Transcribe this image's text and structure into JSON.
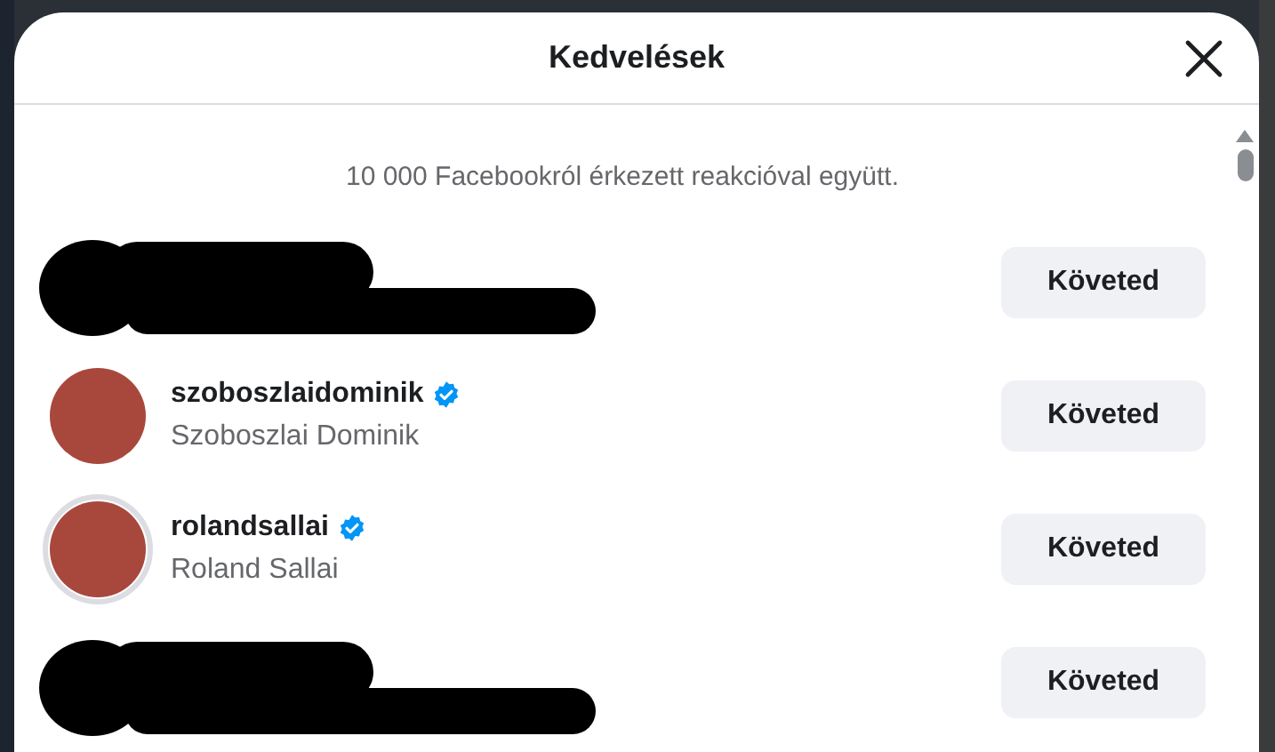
{
  "dialog": {
    "title": "Kedvelések",
    "summary": "10 000 Facebookról érkezett reakcióval együtt."
  },
  "rows": [
    {
      "kind": "redacted",
      "button": "Követed"
    },
    {
      "kind": "user",
      "username": "szoboszlaidominik",
      "verified": true,
      "full_name": "Szoboszlai Dominik",
      "story_ring": false,
      "button": "Követed"
    },
    {
      "kind": "user",
      "username": "rolandsallai",
      "verified": true,
      "full_name": "Roland Sallai",
      "story_ring": true,
      "button": "Követed"
    },
    {
      "kind": "redacted",
      "button": "Követed"
    }
  ]
}
